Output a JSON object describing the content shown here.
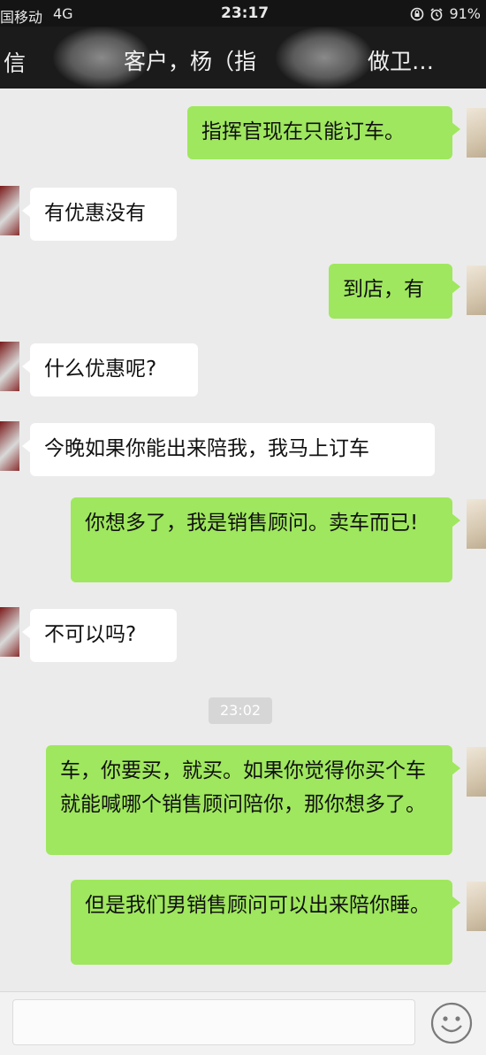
{
  "status_bar": {
    "carrier": "国移动",
    "network": "4G",
    "time": "23:17",
    "battery": "91%"
  },
  "nav": {
    "back_label": "信",
    "title_part1": "客户，杨（指",
    "title_part2": "做卫…"
  },
  "messages": [
    {
      "side": "out",
      "text": "指挥官现在只能订车。"
    },
    {
      "side": "in",
      "text": "有优惠没有"
    },
    {
      "side": "out",
      "text": "到店，有"
    },
    {
      "side": "in",
      "text": "什么优惠呢?"
    },
    {
      "side": "in",
      "text": "今晚如果你能出来陪我，我马上订车"
    },
    {
      "side": "out",
      "text": "你想多了，我是销售顾问。卖车而已!"
    },
    {
      "side": "in",
      "text": "不可以吗?"
    },
    {
      "side": "out",
      "text": "车，你要买，就买。如果你觉得你买个车就能喊哪个销售顾问陪你，那你想多了。"
    },
    {
      "side": "out",
      "text": "但是我们男销售顾问可以出来陪你睡。"
    }
  ],
  "timestamp": "23:02",
  "colors": {
    "outgoing_bubble": "#9fe75e",
    "incoming_bubble": "#ffffff",
    "chat_background": "#ebebeb",
    "nav_background": "#1b1b1b"
  },
  "icons": {
    "alarm": "alarm-icon",
    "rotation_lock": "rotation-lock-icon",
    "battery": "battery-icon",
    "emoji": "emoji-icon"
  }
}
